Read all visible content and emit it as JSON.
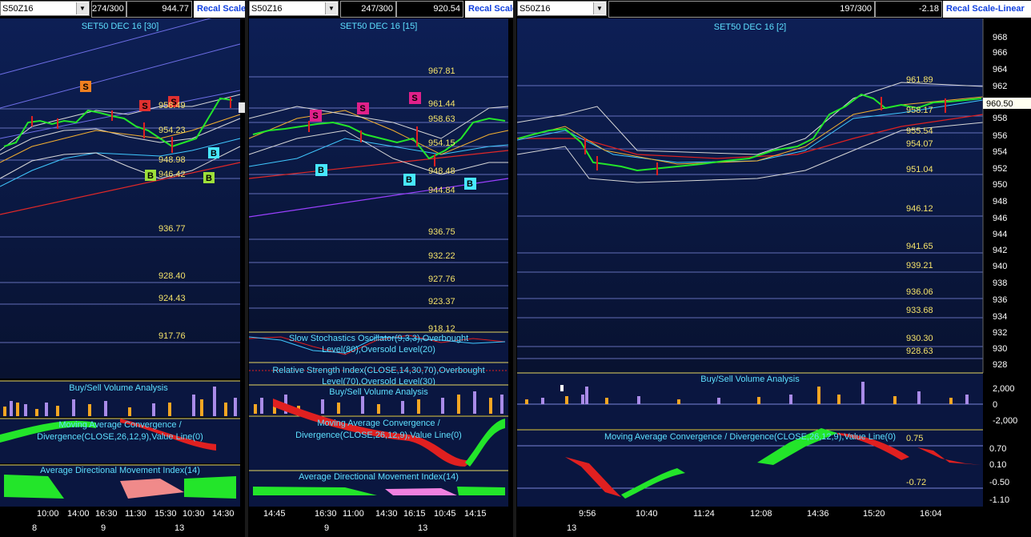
{
  "panels": [
    {
      "symbol": "S50Z16",
      "count": "274/300",
      "value": "944.77",
      "recal": "Recal Scale",
      "title": "SET50 DEC 16  [30]",
      "price_labels": [
        "958.49",
        "954.23",
        "948.98",
        "946.42",
        "936.77",
        "928.40",
        "924.43",
        "917.76"
      ],
      "partial_label": "9",
      "signals": [
        "S",
        "S",
        "S",
        "B",
        "B",
        "B"
      ],
      "indicators": [
        "Buy/Sell Volume Analysis",
        "Moving Average Convergence /",
        "Divergence(CLOSE,26,12,9),Value Line(0)",
        "Average Directional Movement Index(14)"
      ],
      "time_labels": [
        "10:00",
        "14:00",
        "16:30",
        "11:30",
        "15:30",
        "10:30",
        "14:30"
      ],
      "date_labels": [
        "8",
        "9",
        "13"
      ]
    },
    {
      "symbol": "S50Z16",
      "count": "247/300",
      "value": "920.54",
      "recal": "Recal Scale",
      "title": "SET50 DEC 16  [15]",
      "price_labels": [
        "967.81",
        "961.44",
        "958.63",
        "954.15",
        "948.48",
        "944.84",
        "936.75",
        "932.22",
        "927.76",
        "923.37",
        "918.12"
      ],
      "signals": [
        "S",
        "S",
        "S",
        "B",
        "B",
        "B"
      ],
      "indicators": [
        "Slow Stochastics Oscillator(9,3,3),Overbought",
        "Level(80),Oversold Level(20)",
        "Relative Strength Index(CLOSE,14,30,70),Overbought",
        "Level(70),Oversold Level(30)",
        "Buy/Sell Volume Analysis",
        "Moving Average Convergence /",
        "Divergence(CLOSE,26,12,9),Value Line(0)",
        "Average Directional Movement Index(14)"
      ],
      "time_labels": [
        "14:45",
        "16:30",
        "11:00",
        "14:30",
        "16:15",
        "10:45",
        "14:15"
      ],
      "date_labels": [
        "9",
        "13"
      ]
    },
    {
      "symbol": "S50Z16",
      "count": "197/300",
      "value": "-2.18",
      "recal": "Recal Scale-Linear",
      "title": "SET50 DEC 16  [2]",
      "price_labels": [
        "961.89",
        "958.17",
        "955.54",
        "954.07",
        "951.04",
        "946.12",
        "941.65",
        "939.21",
        "936.06",
        "933.68",
        "930.30",
        "928.63"
      ],
      "current_price": "960.50",
      "axis_ticks": [
        "968",
        "966",
        "964",
        "962",
        "960",
        "958",
        "956",
        "954",
        "952",
        "950",
        "948",
        "946",
        "944",
        "942",
        "940",
        "938",
        "936",
        "934",
        "932",
        "930",
        "928"
      ],
      "volume_axis": [
        "2,000",
        "0",
        "-2,000"
      ],
      "macd_axis": [
        "0.70",
        "0.10",
        "-0.50",
        "-1.10"
      ],
      "macd_values": [
        "0.75",
        "-0.72"
      ],
      "indicators": [
        "Buy/Sell Volume Analysis",
        "Moving Average Convergence / Divergence(CLOSE,26,12,9),Value Line(0)"
      ],
      "time_labels": [
        "9:56",
        "10:40",
        "11:24",
        "12:08",
        "14:36",
        "15:20",
        "16:04"
      ],
      "date_labels": [
        "13"
      ]
    }
  ],
  "colors": {
    "bg_top": "#0c1c48",
    "bg_bottom": "#081230",
    "grid": "#7a84d8",
    "price_text": "#f5e36a",
    "title_text": "#5ee0ff",
    "candle_up": "#23e52a",
    "candle_down": "#e02020",
    "vol_buy": "#f5a623",
    "vol_sell": "#a98be8",
    "sell_tag": "#e03030",
    "buy_tag": "#9ee03a",
    "recal_text": "#1040e0"
  }
}
